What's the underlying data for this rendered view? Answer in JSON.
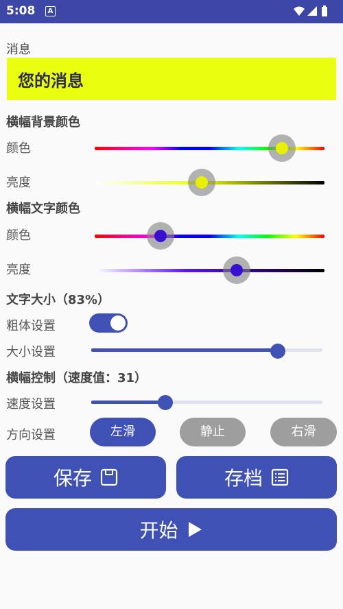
{
  "status_bar": {
    "time": "5:08",
    "notification_icon": "A"
  },
  "message": {
    "label": "消息",
    "value": "您的消息"
  },
  "banner_background": {
    "title": "横幅背景颜色",
    "color_label": "颜色",
    "brightness_label": "亮度",
    "color_value": 0.82,
    "brightness_value": 0.46
  },
  "banner_text": {
    "title": "横幅文字颜色",
    "color_label": "颜色",
    "brightness_label": "亮度",
    "color_value": 0.29,
    "brightness_value": 0.62
  },
  "text_size": {
    "title": "文字大小（83%）",
    "bold_label": "粗体设置",
    "bold_on": true,
    "size_label": "大小设置",
    "size_value": 0.83
  },
  "banner_control": {
    "title": "横幅控制（速度值：31）",
    "speed_label": "速度设置",
    "speed_value": 0.31,
    "direction_label": "方向设置",
    "directions": [
      "左滑",
      "静止",
      "右滑"
    ],
    "selected_direction": "左滑"
  },
  "buttons": {
    "save": "保存",
    "archive": "存档",
    "start": "开始"
  },
  "colors": {
    "accent": "#3f51b5",
    "status_bar": "#3b46a6",
    "message_bg": "#eaff0f",
    "pill_inactive": "#9e9e9e"
  }
}
